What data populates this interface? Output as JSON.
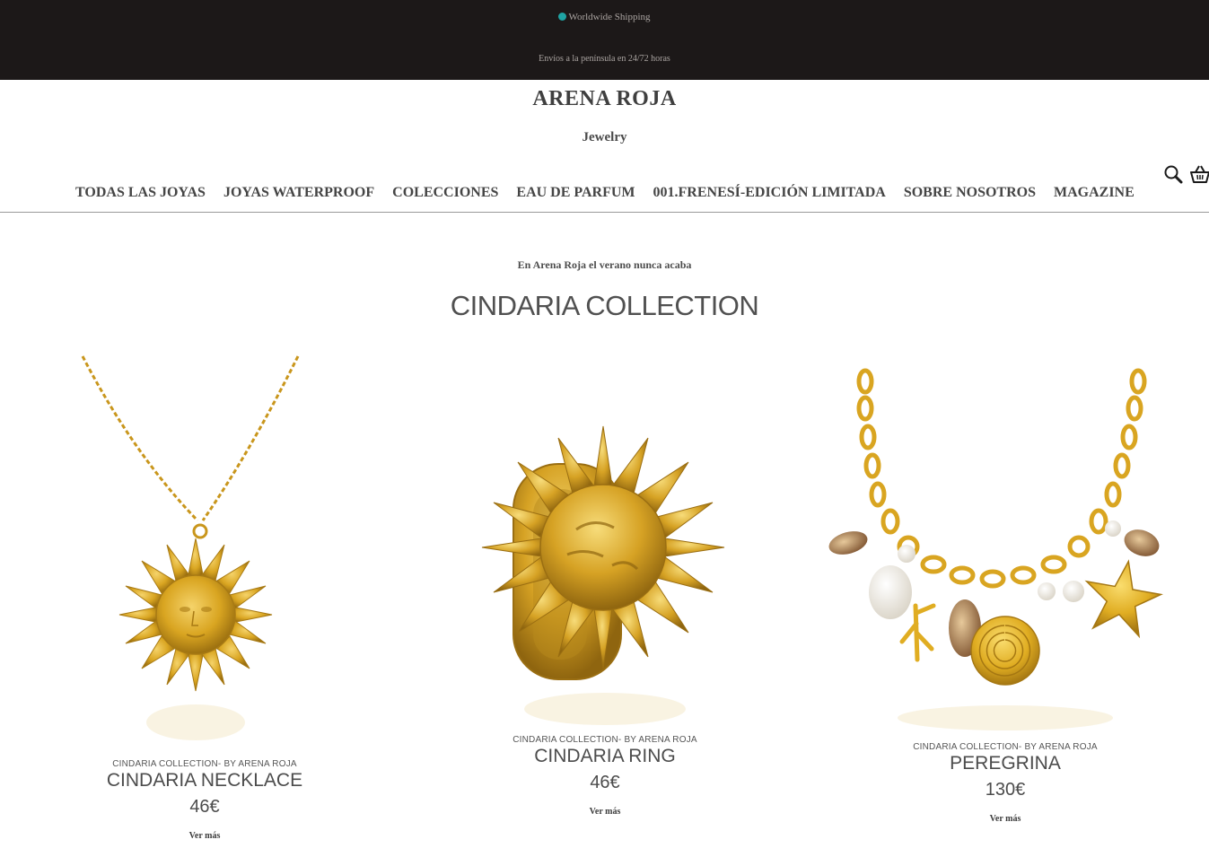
{
  "announcement": {
    "shipping": "Worldwide Shipping",
    "delivery": "Envíos a la península en 24/72 horas"
  },
  "brand": {
    "name": "ARENA ROJA",
    "tagline": "Jewelry"
  },
  "nav": {
    "items": [
      "TODAS LAS JOYAS",
      "JOYAS WATERPROOF",
      "COLECCIONES",
      "EAU DE PARFUM",
      "001.FRENESÍ-EDICIÓN LIMITADA",
      "SOBRE NOSOTROS",
      "MAGAZINE"
    ]
  },
  "header_icons": [
    "search-icon",
    "basket-icon"
  ],
  "main": {
    "intro": "En Arena Roja el verano nunca acaba",
    "title": "CINDARIA COLLECTION"
  },
  "products": [
    {
      "collection": "CINDARIA COLLECTION- BY ARENA ROJA",
      "name": "CINDARIA NECKLACE",
      "price": "46€",
      "cta": "Ver más",
      "image": "sun-pendant-necklace"
    },
    {
      "collection": "CINDARIA COLLECTION- BY ARENA ROJA",
      "name": "CINDARIA RING",
      "price": "46€",
      "cta": "Ver más",
      "image": "sun-ring"
    },
    {
      "collection": "CINDARIA COLLECTION- BY ARENA ROJA",
      "name": "PEREGRINA",
      "price": "130€",
      "cta": "Ver más",
      "image": "shell-charm-necklace"
    }
  ],
  "colors": {
    "topbar": "#1c1818",
    "gold": "#d9a521",
    "accent_dot": "#1fa3a3"
  }
}
